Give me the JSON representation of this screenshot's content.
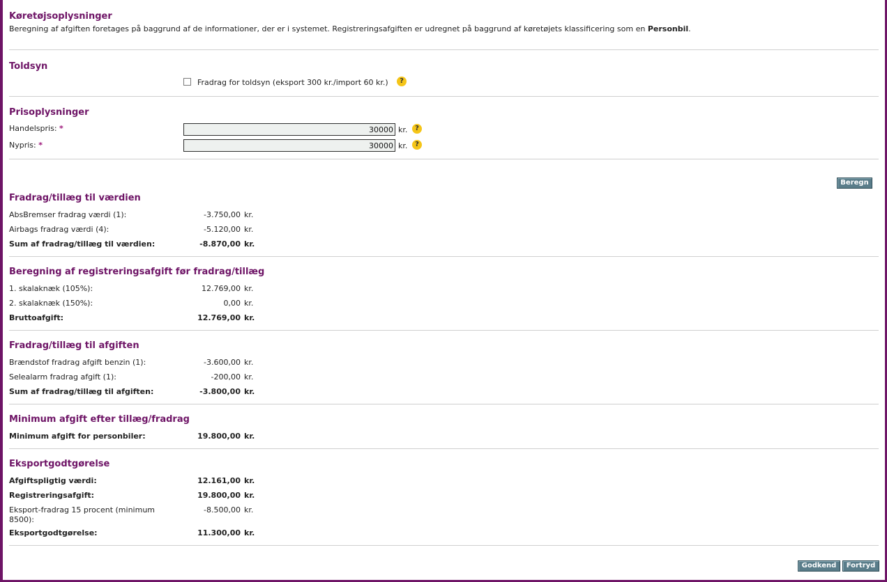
{
  "vehicle": {
    "heading": "Køretøjsoplysninger",
    "desc_prefix": "Beregning af afgiften foretages på baggrund af de informationer, der er i systemet. Registreringsafgiften er udregnet på baggrund af køretøjets klassificering som en ",
    "desc_class": "Personbil",
    "desc_suffix": "."
  },
  "toldsyn": {
    "heading": "Toldsyn",
    "checkbox_label": "Fradrag for toldsyn (eksport 300 kr./import 60 kr.)",
    "checked": false
  },
  "price": {
    "heading": "Prisoplysninger",
    "handelspris_label": "Handelspris:",
    "handelspris_value": "30000",
    "nypris_label": "Nypris:",
    "nypris_value": "30000",
    "required_mark": "*",
    "unit": "kr."
  },
  "help_glyph": "?",
  "buttons": {
    "beregn": "Beregn",
    "godkend": "Godkend",
    "fortryd": "Fortryd"
  },
  "unit": "kr.",
  "value_deductions": {
    "heading": "Fradrag/tillæg til værdien",
    "rows": [
      {
        "label": "AbsBremser fradrag værdi (1):",
        "value": "-3.750,00"
      },
      {
        "label": "Airbags fradrag værdi (4):",
        "value": "-5.120,00"
      },
      {
        "label": "Sum af fradrag/tillæg til værdien:",
        "value": "-8.870,00"
      }
    ]
  },
  "gross_calc": {
    "heading": "Beregning af registreringsafgift før fradrag/tillæg",
    "rows": [
      {
        "label": "1. skalaknæk (105%):",
        "value": "12.769,00"
      },
      {
        "label": "2. skalaknæk (150%):",
        "value": "0,00"
      },
      {
        "label": "Bruttoafgift:",
        "value": "12.769,00"
      }
    ]
  },
  "fee_deductions": {
    "heading": "Fradrag/tillæg til afgiften",
    "rows": [
      {
        "label": "Brændstof fradrag afgift benzin (1):",
        "value": "-3.600,00"
      },
      {
        "label": "Selealarm fradrag afgift (1):",
        "value": "-200,00"
      },
      {
        "label": "Sum af fradrag/tillæg til afgiften:",
        "value": "-3.800,00"
      }
    ]
  },
  "minimum": {
    "heading": "Minimum afgift efter tillæg/fradrag",
    "rows": [
      {
        "label": "Minimum afgift for personbiler:",
        "value": "19.800,00"
      }
    ]
  },
  "export": {
    "heading": "Eksportgodtgørelse",
    "rows": [
      {
        "label": "Afgiftspligtig værdi:",
        "value": "12.161,00"
      },
      {
        "label": "Registreringsafgift:",
        "value": "19.800,00"
      },
      {
        "label": "Eksport-fradrag 15 procent (minimum",
        "label2": "8500):",
        "value": "-8.500,00"
      },
      {
        "label": "Eksportgodtgørelse:",
        "value": "11.300,00"
      }
    ]
  }
}
